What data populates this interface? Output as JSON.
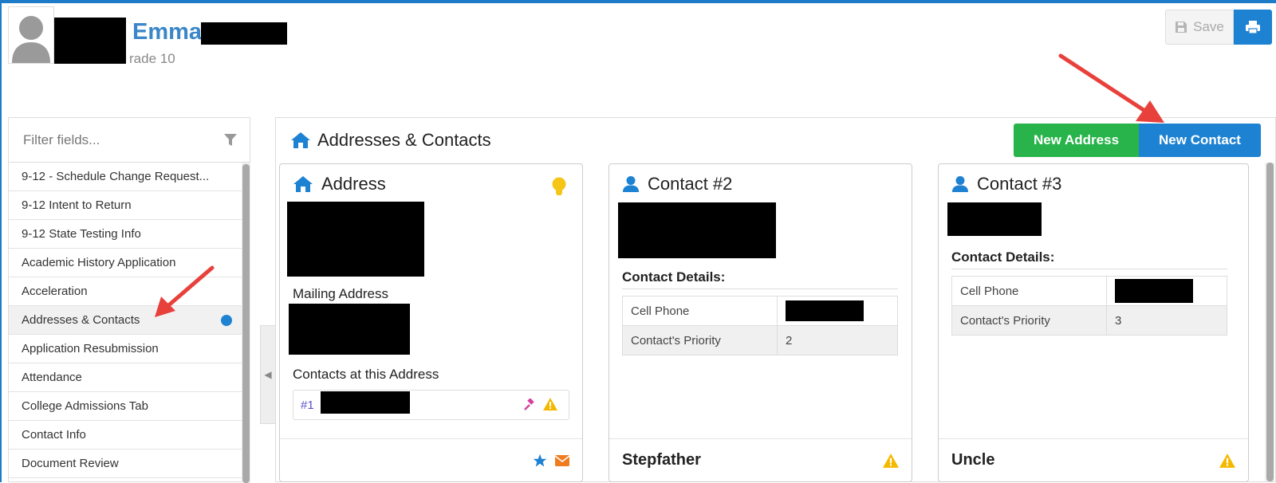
{
  "header": {
    "student_name": "Emma",
    "student_grade": "rade 10",
    "save_label": "Save"
  },
  "sidebar": {
    "filter_placeholder": "Filter fields...",
    "items": [
      {
        "label": "9-12 - Schedule Change Request..."
      },
      {
        "label": "9-12 Intent to Return"
      },
      {
        "label": "9-12 State Testing Info"
      },
      {
        "label": "Academic History Application"
      },
      {
        "label": "Acceleration"
      },
      {
        "label": "Addresses & Contacts",
        "active": true
      },
      {
        "label": "Application Resubmission"
      },
      {
        "label": "Attendance"
      },
      {
        "label": "College Admissions Tab"
      },
      {
        "label": "Contact Info"
      },
      {
        "label": "Document Review"
      }
    ]
  },
  "panel": {
    "title": "Addresses & Contacts",
    "new_address_label": "New Address",
    "new_contact_label": "New Contact"
  },
  "cards": {
    "address": {
      "title": "Address",
      "mailing_label": "Mailing Address",
      "contacts_label": "Contacts at this Address",
      "contact_ref": "#1"
    },
    "contact2": {
      "title": "Contact #2",
      "details_label": "Contact Details:",
      "rows": [
        {
          "label": "Cell Phone",
          "value": ""
        },
        {
          "label": "Contact's Priority",
          "value": "2"
        }
      ],
      "relationship": "Stepfather"
    },
    "contact3": {
      "title": "Contact #3",
      "details_label": "Contact Details:",
      "rows": [
        {
          "label": "Cell Phone",
          "value": ""
        },
        {
          "label": "Contact's Priority",
          "value": "3"
        }
      ],
      "relationship": "Uncle"
    }
  },
  "colors": {
    "accent_blue": "#1e82d2",
    "success_green": "#28b44a",
    "warning_yellow": "#f5b800",
    "annotation_red": "#e8413c"
  }
}
